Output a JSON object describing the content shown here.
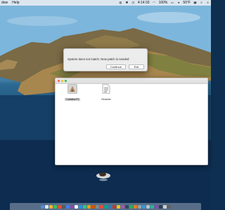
{
  "menubar": {
    "left_items": [
      "dow",
      "Help"
    ],
    "status": {
      "battery": "100%",
      "clock": "4:14 03",
      "temperature": "50°F"
    }
  },
  "dialog": {
    "message": "System does not match. New patch is needed",
    "buttons": {
      "continue": "Continue",
      "exit": "Exit"
    }
  },
  "finder": {
    "title": "",
    "items": [
      {
        "label": "Catalina Pt",
        "icon": "installer-icon",
        "selected": true
      },
      {
        "label": "Readme",
        "icon": "document-icon",
        "selected": false
      }
    ]
  },
  "dock": {
    "colors": [
      "#4a8fe0",
      "#e8e8e8",
      "#f2b134",
      "#39c05f",
      "#e84c3d",
      "#5a5a5a",
      "#3b82f6",
      "#8e44ad",
      "#f5f5f5",
      "#1e90ff",
      "#2ecc71",
      "#f39c12",
      "#d35400",
      "#7f8c8d",
      "#e74c3c",
      "#16a085",
      "#2980b9",
      "#c0392b",
      "#f1c40f",
      "#9b59b6",
      "#34495e",
      "#27ae60",
      "#e67e22",
      "#95a5a6",
      "#3498db",
      "#bdc3c7",
      "#1abc9c",
      "#8e44ad",
      "#2c3e50",
      "#d0d0d0",
      "#606060"
    ]
  }
}
